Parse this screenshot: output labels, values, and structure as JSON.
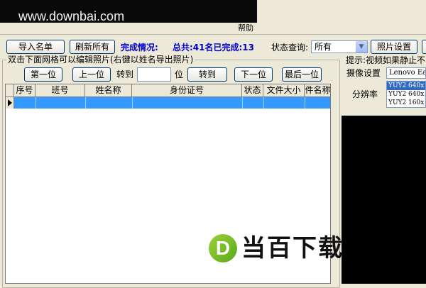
{
  "watermark": {
    "text": "www.downbai.com"
  },
  "menu": {
    "help": "帮助"
  },
  "toolbar": {
    "import_label": "导入名单",
    "refresh_label": "刷新所有",
    "completion_label": "完成情况:",
    "completion_value": "总共:41名已完成:13",
    "status_query_label": "状态查询:",
    "status_query_value": "所有",
    "photo_settings_label": "照片设置"
  },
  "grid_group": {
    "title": "双击下面网格可以编辑照片(右键以姓名导出照片)",
    "first_label": "第一位",
    "prev_label": "上一位",
    "goto_label": "转到",
    "position_unit": "位",
    "goto_button_label": "转到",
    "next_label": "下一位",
    "last_label": "最后一位"
  },
  "grid": {
    "columns": [
      "序号",
      "班号",
      "姓名称",
      "身份证号",
      "状态",
      "文件大小",
      "件名称"
    ]
  },
  "right_panel": {
    "tip_text": "提示:视频如果静止不",
    "camera_label": "摄像设置",
    "camera_value": "Lenovo Ea",
    "resolution_label": "分辨率",
    "resolutions": [
      "YUY2 640x",
      "YUY2 640x",
      "YUY2 160x"
    ]
  },
  "brand": {
    "logo_letter": "D",
    "logo_text": "当百下载"
  },
  "colors": {
    "selection": "#3399ff",
    "accent_text": "#0000cc",
    "window_bg": "#ece9d8"
  }
}
